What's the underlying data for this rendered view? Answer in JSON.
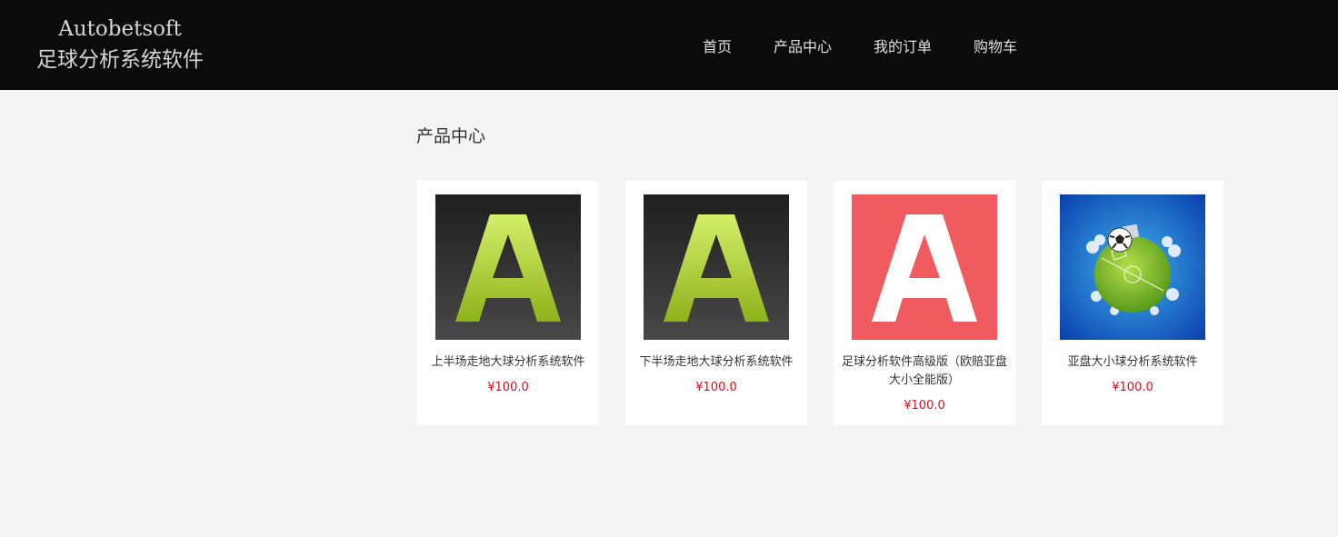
{
  "header": {
    "logo_line1": "Autobetsoft",
    "logo_line2": "足球分析系统软件",
    "nav": [
      "首页",
      "产品中心",
      "我的订单",
      "购物车"
    ]
  },
  "main": {
    "section_title": "产品中心",
    "products": [
      {
        "name": "上半场走地大球分析系统软件",
        "price": "¥100.0",
        "icon": "letter-a-green-dark-icon"
      },
      {
        "name": "下半场走地大球分析系统软件",
        "price": "¥100.0",
        "icon": "letter-a-green-dark-icon"
      },
      {
        "name": "足球分析软件高级版（欧赔亚盘大小全能版）",
        "price": "¥100.0",
        "icon": "letter-a-white-red-icon"
      },
      {
        "name": "亚盘大小球分析系统软件",
        "price": "¥100.0",
        "icon": "soccer-planet-icon"
      }
    ]
  },
  "colors": {
    "header_bg": "#0b0b0b",
    "page_bg": "#f4f4f4",
    "price": "#d6101b",
    "accent_red": "#ef5b5e",
    "accent_green": "#a8cc2a"
  }
}
